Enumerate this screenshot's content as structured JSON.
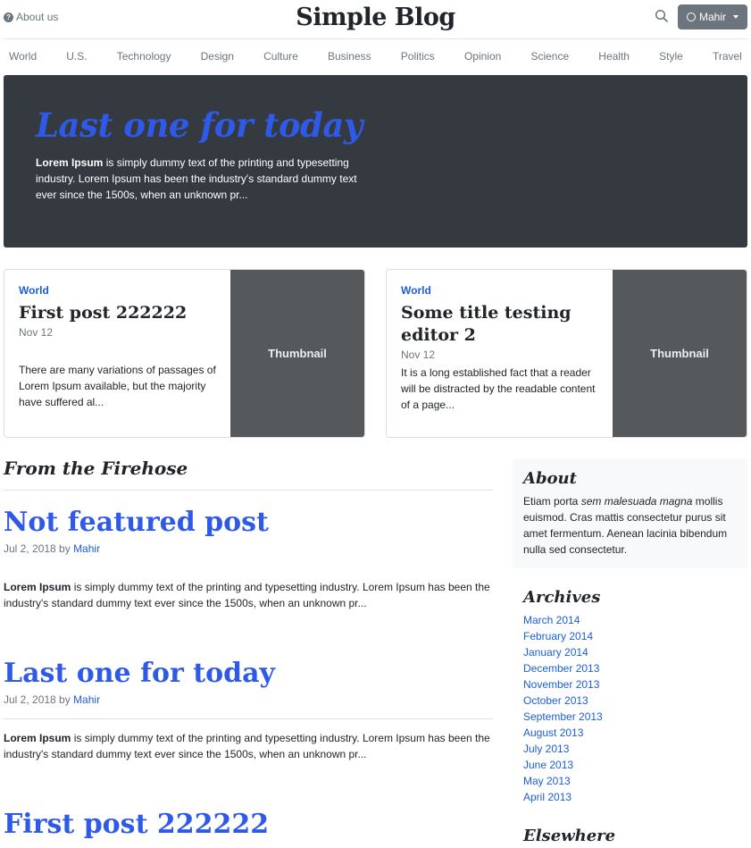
{
  "header": {
    "about_label": "About us",
    "brand": "Simple Blog",
    "user_label": "Mahir"
  },
  "nav": [
    "World",
    "U.S.",
    "Technology",
    "Design",
    "Culture",
    "Business",
    "Politics",
    "Opinion",
    "Science",
    "Health",
    "Style",
    "Travel"
  ],
  "jumbotron": {
    "title": "Last one for today",
    "lead_bold": "Lorem Ipsum",
    "lead_text": " is simply dummy text of the printing and typesetting industry. Lorem Ipsum has been the industry's standard dummy text ever since the 1500s, when an unknown pr..."
  },
  "cards": [
    {
      "category": "World",
      "title": "First post 222222",
      "date": "Nov 12",
      "text": "There are many variations of passages of Lorem Ipsum available, but the majority have suffered al...",
      "thumb": "Thumbnail"
    },
    {
      "category": "World",
      "title": "Some title testing editor 2",
      "date": "Nov 12",
      "text": "It is a long established fact that a reader will be distracted by the readable content of a page...",
      "thumb": "Thumbnail"
    }
  ],
  "main": {
    "heading": "From the Firehose",
    "posts": [
      {
        "title": "Not featured post",
        "date": "Jul 2, 2018 by ",
        "author": "Mahir",
        "bold": "Lorem Ipsum",
        "text": " is simply dummy text of the printing and typesetting industry. Lorem Ipsum has been the industry's standard dummy text ever since the 1500s, when an unknown pr..."
      },
      {
        "title": "Last one for today",
        "date": "Jul 2, 2018 by ",
        "author": "Mahir",
        "bold": "Lorem Ipsum",
        "text": " is simply dummy text of the printing and typesetting industry. Lorem Ipsum has been the industry's standard dummy text ever since the 1500s, when an unknown pr..."
      },
      {
        "title": "First post 222222"
      }
    ]
  },
  "sidebar": {
    "about_heading": "About",
    "about_pre": "Etiam porta ",
    "about_em": "sem malesuada magna",
    "about_post": " mollis euismod. Cras mattis consectetur purus sit amet fermentum. Aenean lacinia bibendum nulla sed consectetur.",
    "archives_heading": "Archives",
    "archives": [
      "March 2014",
      "February 2014",
      "January 2014",
      "December 2013",
      "November 2013",
      "October 2013",
      "September 2013",
      "August 2013",
      "July 2013",
      "June 2013",
      "May 2013",
      "April 2013"
    ],
    "elsewhere_heading": "Elsewhere"
  }
}
